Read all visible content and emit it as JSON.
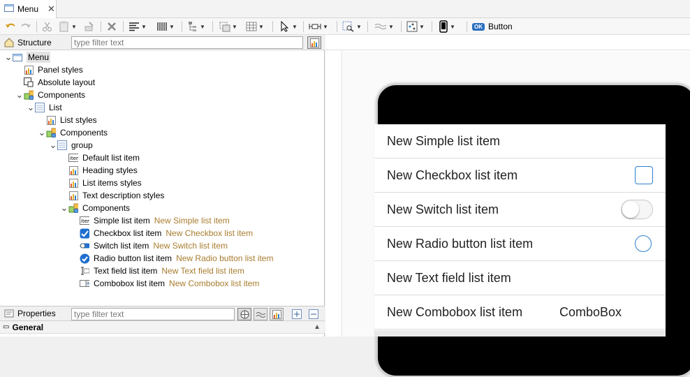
{
  "tab": {
    "label": "Menu"
  },
  "toolbar": {
    "button_label": "Button",
    "ok_badge": "OK"
  },
  "structure": {
    "title": "Structure",
    "filter_placeholder": "type filter text",
    "tree": [
      {
        "label": "Menu",
        "hint": ""
      },
      {
        "label": "Panel styles",
        "hint": ""
      },
      {
        "label": "Absolute layout",
        "hint": ""
      },
      {
        "label": "Components",
        "hint": ""
      },
      {
        "label": "List",
        "hint": ""
      },
      {
        "label": "List styles",
        "hint": ""
      },
      {
        "label": "Components",
        "hint": ""
      },
      {
        "label": "group",
        "hint": ""
      },
      {
        "label": "Default list item",
        "hint": ""
      },
      {
        "label": "Heading styles",
        "hint": ""
      },
      {
        "label": "List items styles",
        "hint": ""
      },
      {
        "label": "Text description styles",
        "hint": ""
      },
      {
        "label": "Components",
        "hint": ""
      },
      {
        "label": "Simple list item",
        "hint": "New Simple list item"
      },
      {
        "label": "Checkbox list item",
        "hint": "New Checkbox list item"
      },
      {
        "label": "Switch list item",
        "hint": "New Switch list item"
      },
      {
        "label": "Radio button list item",
        "hint": "New Radio button list item"
      },
      {
        "label": "Text field list item",
        "hint": "New Text field list item"
      },
      {
        "label": "Combobox list item",
        "hint": "New Combobox list item"
      }
    ]
  },
  "properties": {
    "title": "Properties",
    "filter_placeholder": "type filter text",
    "section": "General"
  },
  "preview": {
    "items": [
      {
        "label": "New Simple list item"
      },
      {
        "label": "New Checkbox list item"
      },
      {
        "label": "New Switch list item"
      },
      {
        "label": "New Radio button list item"
      },
      {
        "label": "New Text field list item"
      },
      {
        "label": "New Combobox list item",
        "value": "ComboBox"
      }
    ]
  },
  "colors": {
    "accent": "#2e7fd1",
    "hint": "#a87c2e",
    "selection": "#e2e2e2"
  }
}
